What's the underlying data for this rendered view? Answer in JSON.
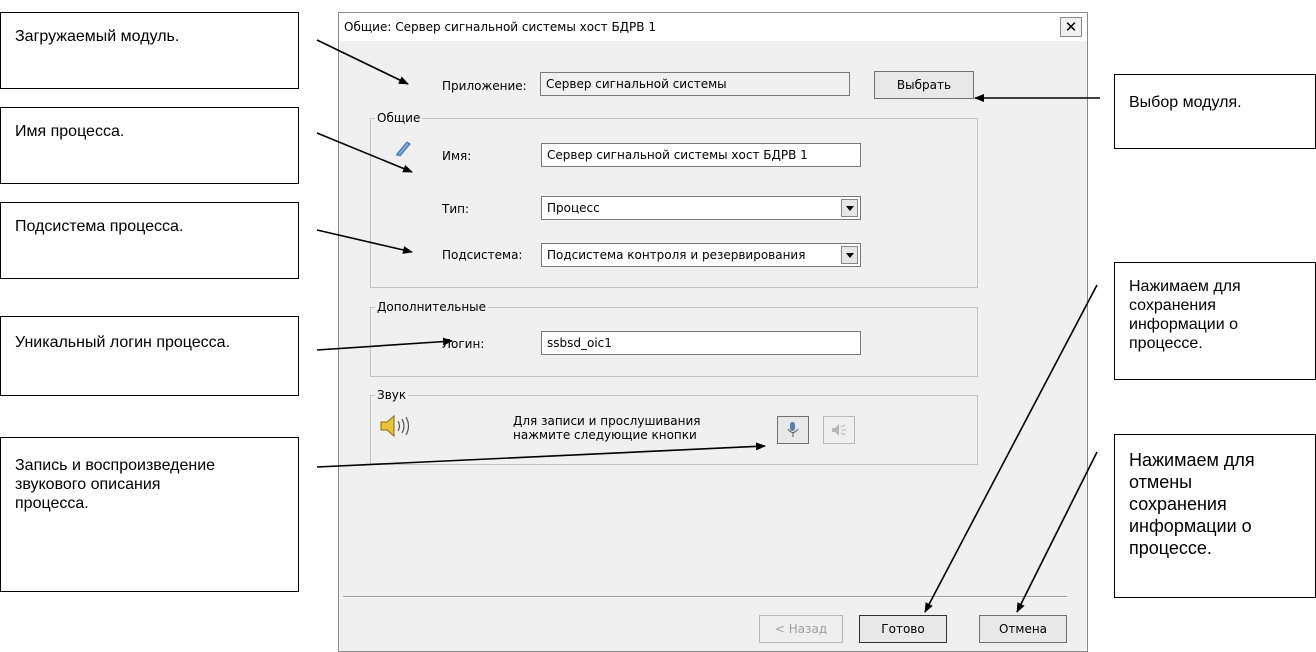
{
  "dialog": {
    "title": "Общие: Сервер сигнальной системы хост БДРВ 1",
    "close_label": "✕",
    "application_label": "Приложение:",
    "application_value": "Сервер сигнальной системы",
    "select_button": "Выбрать",
    "general_group": "Общие",
    "name_label": "Имя:",
    "name_value": "Сервер сигнальной системы хост БДРВ 1",
    "type_label": "Тип:",
    "type_value": "Процесс",
    "subsystem_label": "Подсистема:",
    "subsystem_value": "Подсистема контроля и резервирования",
    "additional_group": "Дополнительные",
    "login_label": "Логин:",
    "login_value": "ssbsd_oic1",
    "sound_group": "Звук",
    "sound_hint_1": "Для записи и прослушивания",
    "sound_hint_2": "нажмите следующие кнопки",
    "back_button": "< Назад",
    "done_button": "Готово",
    "cancel_button": "Отмена"
  },
  "callouts": {
    "module": "Загружаемый модуль.",
    "process_name": "Имя процесса.",
    "subsystem": "Подсистема процесса.",
    "login": "Уникальный логин процесса.",
    "sound": "Запись и воспроизведение звукового описания процесса.",
    "select_module": "Выбор модуля.",
    "save": "Нажимаем для сохранения информации о процессе.",
    "cancel": "Нажимаем для отмены сохранения информации о процессе."
  },
  "icons": {
    "name_icon": "pencil-icon",
    "sound_icon": "speaker-icon",
    "record_icon": "microphone-icon",
    "play_icon": "speaker-play-icon",
    "dropdown_icon": "chevron-down-icon"
  }
}
